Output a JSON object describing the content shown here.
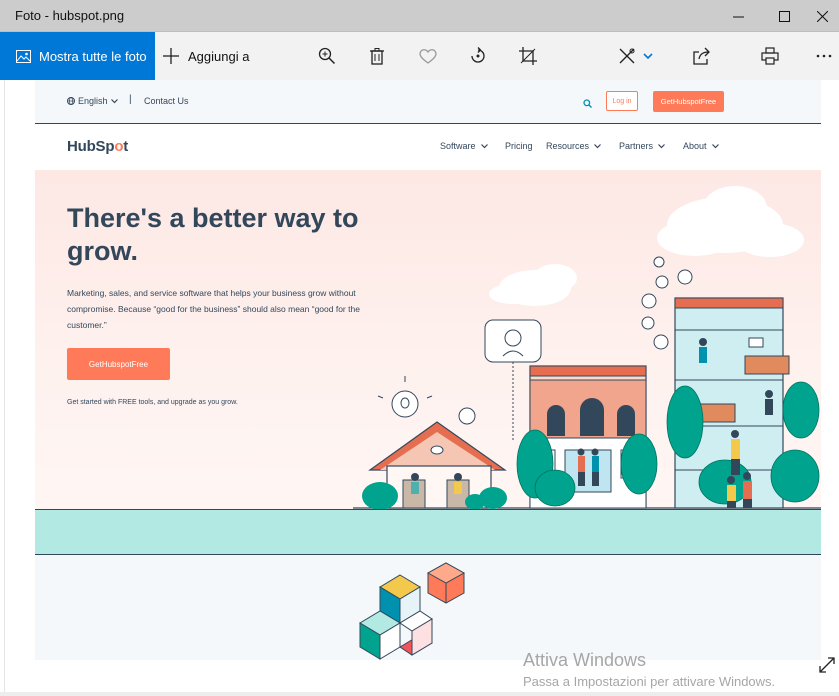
{
  "window": {
    "title": "Foto - hubspot.png"
  },
  "toolbar": {
    "show_all_label": "Mostra tutte le foto",
    "add_label": "Aggiungi a",
    "accent_color": "#0078d7"
  },
  "page": {
    "utility": {
      "language": "English",
      "separator": "|",
      "contact": "Contact Us",
      "login": "Log in",
      "cta": "GetHubspotFree"
    },
    "logo": {
      "part1": "HubSp",
      "part2": "o",
      "part3": "t"
    },
    "nav": [
      "Software",
      "Pricing",
      "Resources",
      "Partners",
      "About"
    ],
    "hero": {
      "headline": "There's a better way to grow.",
      "subtext": "Marketing, sales, and service software that helps your business grow without compromise. Because “good for the business” should also mean “good for the customer.”",
      "button": "GetHubspotFree",
      "note": "Get started with FREE tools, and upgrade as you grow."
    },
    "brand_color": "#ff7a59",
    "text_color": "#33475b"
  },
  "watermark": {
    "line1": "Attiva Windows",
    "line2": "Passa a Impostazioni per attivare Windows."
  }
}
